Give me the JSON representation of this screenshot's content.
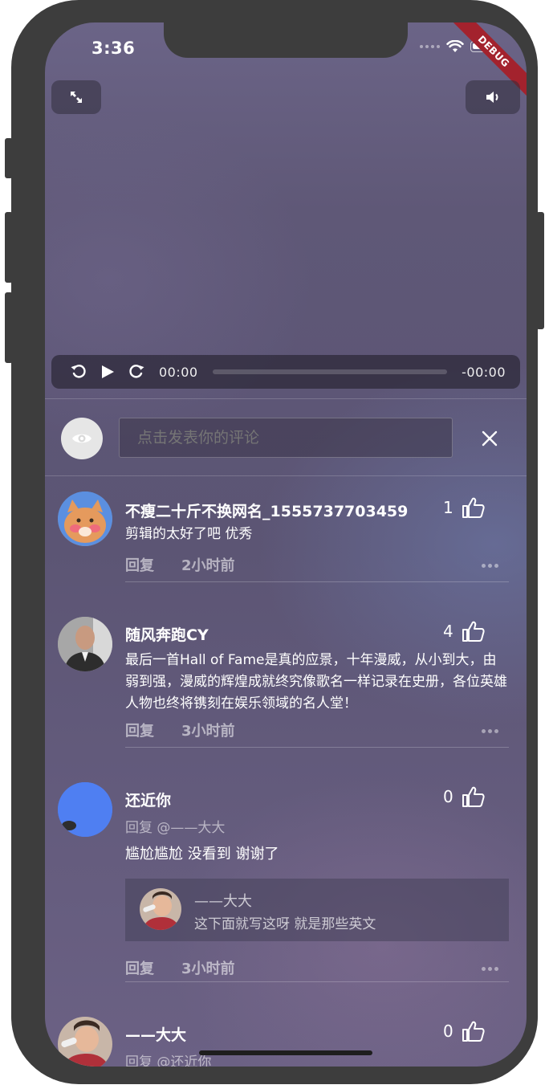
{
  "status": {
    "time": "3:36",
    "debug_label": "DEBUG"
  },
  "player": {
    "current_time": "00:00",
    "remaining_time": "-00:00",
    "progress": 0
  },
  "comment_box": {
    "placeholder": "点击发表你的评论"
  },
  "icons": {
    "fullscreen": "fullscreen-icon",
    "volume": "volume-icon",
    "replay": "rewind-icon",
    "play": "play-icon",
    "forward": "forward-icon",
    "eye": "eye-icon",
    "close": "close-icon",
    "like": "thumbs-up-icon",
    "more": "more-icon"
  },
  "comments": [
    {
      "name": "不瘦二十斤不换网名_1555737703459",
      "likes": "1",
      "text": "剪辑的太好了吧 优秀",
      "reply_label": "回复",
      "time": "2小时前"
    },
    {
      "name": "随风奔跑CY",
      "likes": "4",
      "text": "最后一首Hall of Fame是真的应景，十年漫威，从小到大，由弱到强，漫威的辉煌成就终究像歌名一样记录在史册，各位英雄人物也终将镌刻在娱乐领域的名人堂！",
      "reply_label": "回复",
      "time": "3小时前"
    },
    {
      "name": "还近你",
      "likes": "0",
      "reply_to": "回复 @——大大",
      "text": "尴尬尴尬 没看到  谢谢了",
      "quote": {
        "name": "——大大",
        "text": "这下面就写这呀   就是那些英文"
      },
      "reply_label": "回复",
      "time": "3小时前"
    },
    {
      "name": "——大大",
      "likes": "0",
      "reply_to": "回复 @还近你"
    }
  ]
}
